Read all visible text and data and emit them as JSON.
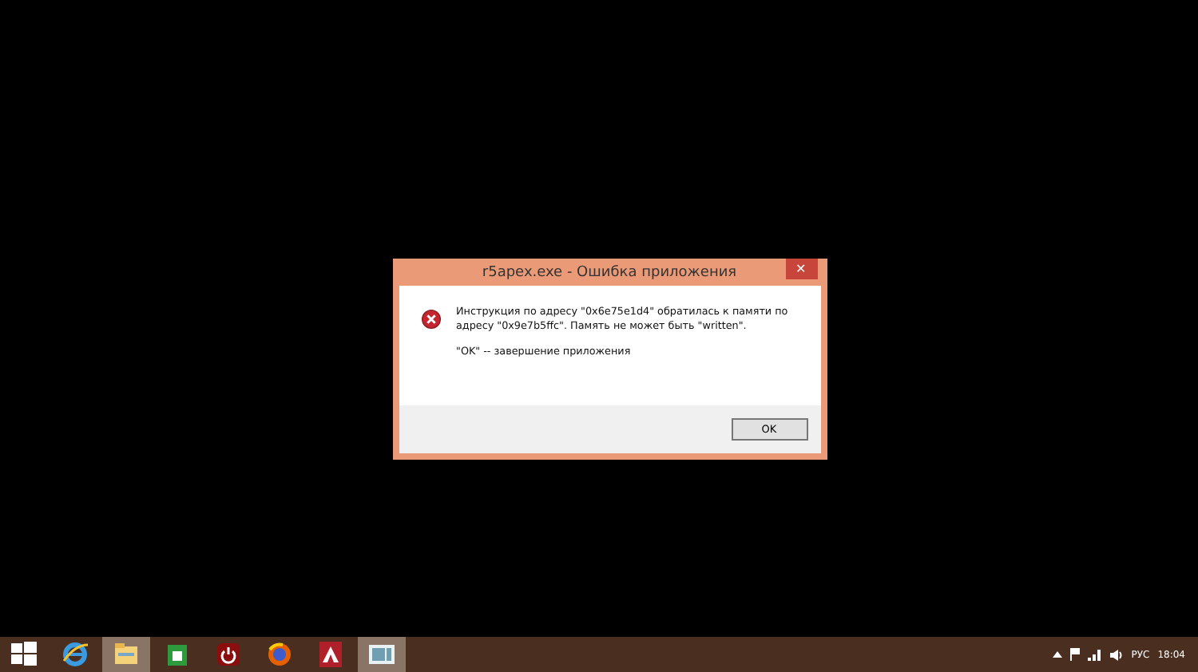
{
  "dialog": {
    "title": "r5apex.exe - Ошибка приложения",
    "close_label": "✕",
    "message": "Инструкция по адресу \"0x6e75e1d4\" обратилась к памяти по адресу \"0x9e7b5ffc\". Память не может быть \"written\".",
    "hint": "\"OK\" -- завершение приложения",
    "buttons": [
      "OK"
    ]
  },
  "taskbar": {
    "items": [
      {
        "kind": "start",
        "highlighted": false
      },
      {
        "kind": "ie",
        "highlighted": false
      },
      {
        "kind": "explorer",
        "highlighted": true
      },
      {
        "kind": "store",
        "highlighted": false
      },
      {
        "kind": "power",
        "highlighted": false
      },
      {
        "kind": "firefox",
        "highlighted": false
      },
      {
        "kind": "redapp",
        "highlighted": false
      },
      {
        "kind": "window",
        "highlighted": true
      }
    ],
    "language": "РУС",
    "time": "18:04"
  }
}
